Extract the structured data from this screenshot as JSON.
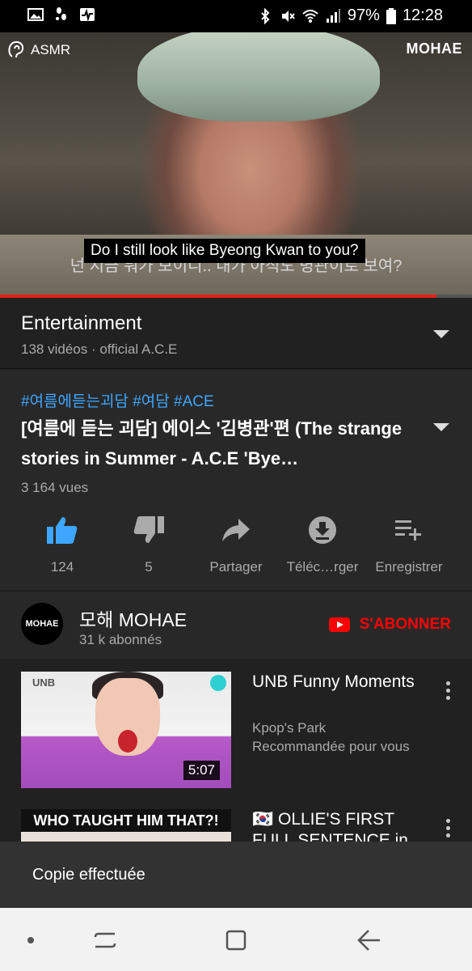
{
  "status_bar": {
    "battery": "97%",
    "time": "12:28",
    "left_icons": [
      "image-icon",
      "walking-icon",
      "pulse-icon"
    ],
    "right_icons": [
      "bluetooth-icon",
      "mute-icon",
      "wifi-icon",
      "signal-icon",
      "battery-icon"
    ]
  },
  "video": {
    "watermark_left": "ASMR",
    "watermark_right": "MOHAE",
    "caption": "Do I still look like Byeong Kwan to you?",
    "burned_subtitle": "넌 지금 뭐가 보이니.. 내가 아직도 병관이로 보여?",
    "progress_percent": 92.5,
    "progress_color": "#e62117"
  },
  "playlist": {
    "title": "Entertainment",
    "meta": "138 vidéos · official A.C.E"
  },
  "video_info": {
    "hashtags": "#여름에듣는괴담 #여담 #ACE",
    "title": "[여름에 듣는 괴담] 에이스 '김병관'편 (The strange stories in Summer - A.C.E 'Bye…",
    "views": "3 164 vues",
    "actions": [
      {
        "name": "like",
        "label": "124",
        "icon": "thumb-up-icon",
        "color": "#3ea6ff"
      },
      {
        "name": "dislike",
        "label": "5",
        "icon": "thumb-down-icon",
        "color": "#aaaaaa"
      },
      {
        "name": "share",
        "label": "Partager",
        "icon": "share-icon",
        "color": "#aaaaaa"
      },
      {
        "name": "download",
        "label": "Téléc…rger",
        "icon": "download-icon",
        "color": "#aaaaaa"
      },
      {
        "name": "save",
        "label": "Enregistrer",
        "icon": "playlist-add-icon",
        "color": "#aaaaaa"
      }
    ]
  },
  "channel": {
    "avatar_text": "MOHAE",
    "name": "모해 MOHAE",
    "subscribers": "31 k abonnés",
    "subscribe_label": "S'ABONNER",
    "subscribe_color": "#ff0000"
  },
  "recommendations": [
    {
      "title": "UNB Funny Moments",
      "channel": "Kpop's Park",
      "reason": "Recommandée pour vous",
      "duration": "5:07",
      "thumb_label": "UNB"
    },
    {
      "title": "🇰🇷 OLLIE'S FIRST FULL SENTENCE in",
      "thumb_banner": "WHO TAUGHT HIM THAT?!"
    }
  ],
  "toast": {
    "text": "Copie effectuée"
  },
  "nav_bar": {
    "buttons": [
      "recents-icon",
      "home-icon",
      "back-icon"
    ]
  }
}
